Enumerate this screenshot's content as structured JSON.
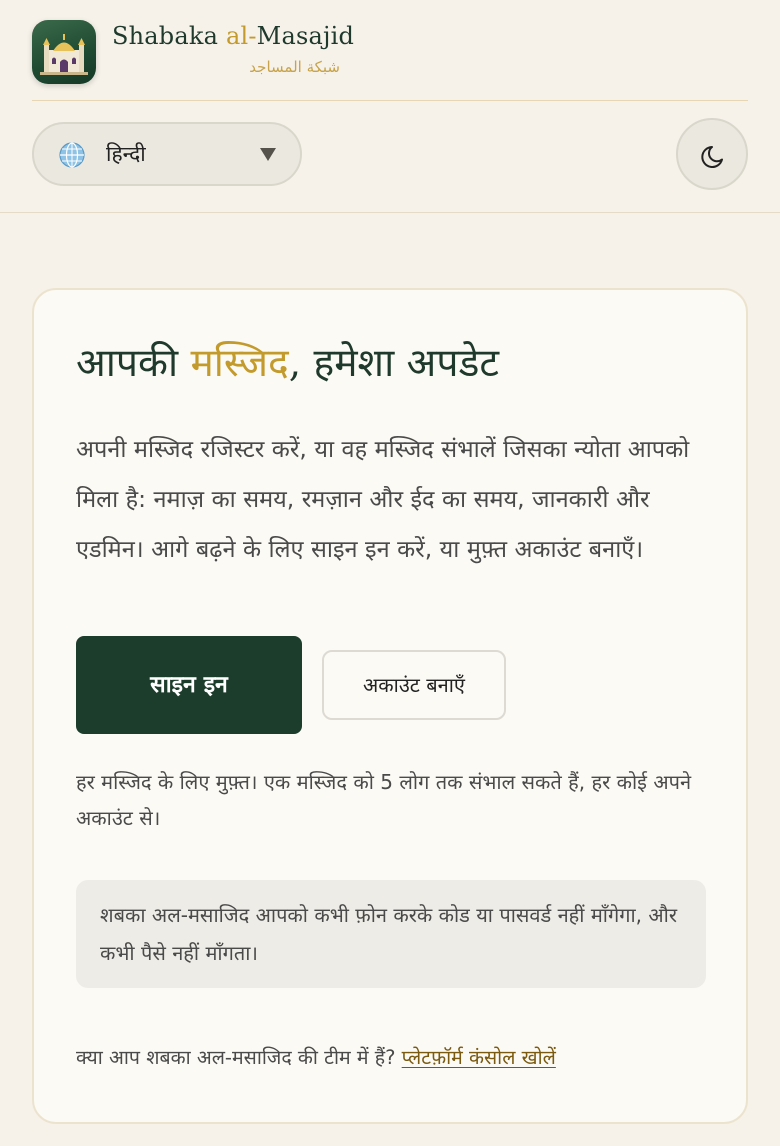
{
  "brand": {
    "name_part1": "Shabaka ",
    "name_accent": "al-",
    "name_part2": "Masajid",
    "arabic_name": "شبكة المساجد"
  },
  "header": {
    "language": {
      "selected": "हिन्दी",
      "icon": "globe-icon"
    },
    "theme_toggle_icon": "moon-icon"
  },
  "hero": {
    "headline_part1": "आपकी ",
    "headline_accent": "मस्जिद",
    "headline_part2": ", हमेशा अपडेट",
    "intro": "अपनी मस्जिद रजिस्टर करें, या वह मस्जिद संभालें जिसका न्योता आपको मिला है: नमाज़ का समय, रमज़ान और ईद का समय, जानकारी और एडमिन। आगे बढ़ने के लिए साइन इन करें, या मुफ़्त अकाउंट बनाएँ।",
    "sign_in_label": "साइन इन",
    "create_account_label": "अकाउंट बनाएँ",
    "free_note": "हर मस्जिद के लिए मुफ़्त। एक मस्जिद को 5 लोग तक संभाल सकते हैं, हर कोई अपने अकाउंट से।",
    "security_notice": "शबका अल-मसाजिद आपको कभी फ़ोन करके कोड या पासवर्ड नहीं माँगेगा, और कभी पैसे नहीं माँगता।",
    "team_question": "क्या आप शबका अल-मसाजिद की टीम में हैं?",
    "console_link": "प्लेटफ़ॉर्म कंसोल खोलें"
  },
  "colors": {
    "background": "#f6f2ea",
    "brand_green": "#1d3d2c",
    "accent_gold": "#c39a2c",
    "link_brown": "#7a5a10"
  }
}
